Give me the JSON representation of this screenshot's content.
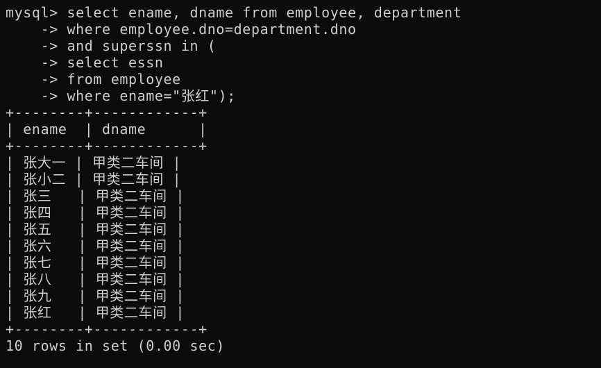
{
  "window": {
    "background": "#0c0c0c",
    "foreground": "#cccccc"
  },
  "lines": [
    "mysql> select ename, dname from employee, department",
    "    -> where employee.dno=department.dno",
    "    -> and superssn in (",
    "    -> select essn",
    "    -> from employee",
    "    -> where ename=\"张红\");",
    "+--------+------------+",
    "| ename  | dname      |",
    "+--------+------------+",
    "| 张大一 | 甲类二车间 |",
    "| 张小二 | 甲类二车间 |",
    "| 张三   | 甲类二车间 |",
    "| 张四   | 甲类二车间 |",
    "| 张五   | 甲类二车间 |",
    "| 张六   | 甲类二车间 |",
    "| 张七   | 甲类二车间 |",
    "| 张八   | 甲类二车间 |",
    "| 张九   | 甲类二车间 |",
    "| 张红   | 甲类二车间 |",
    "+--------+------------+",
    "10 rows in set (0.00 sec)"
  ]
}
